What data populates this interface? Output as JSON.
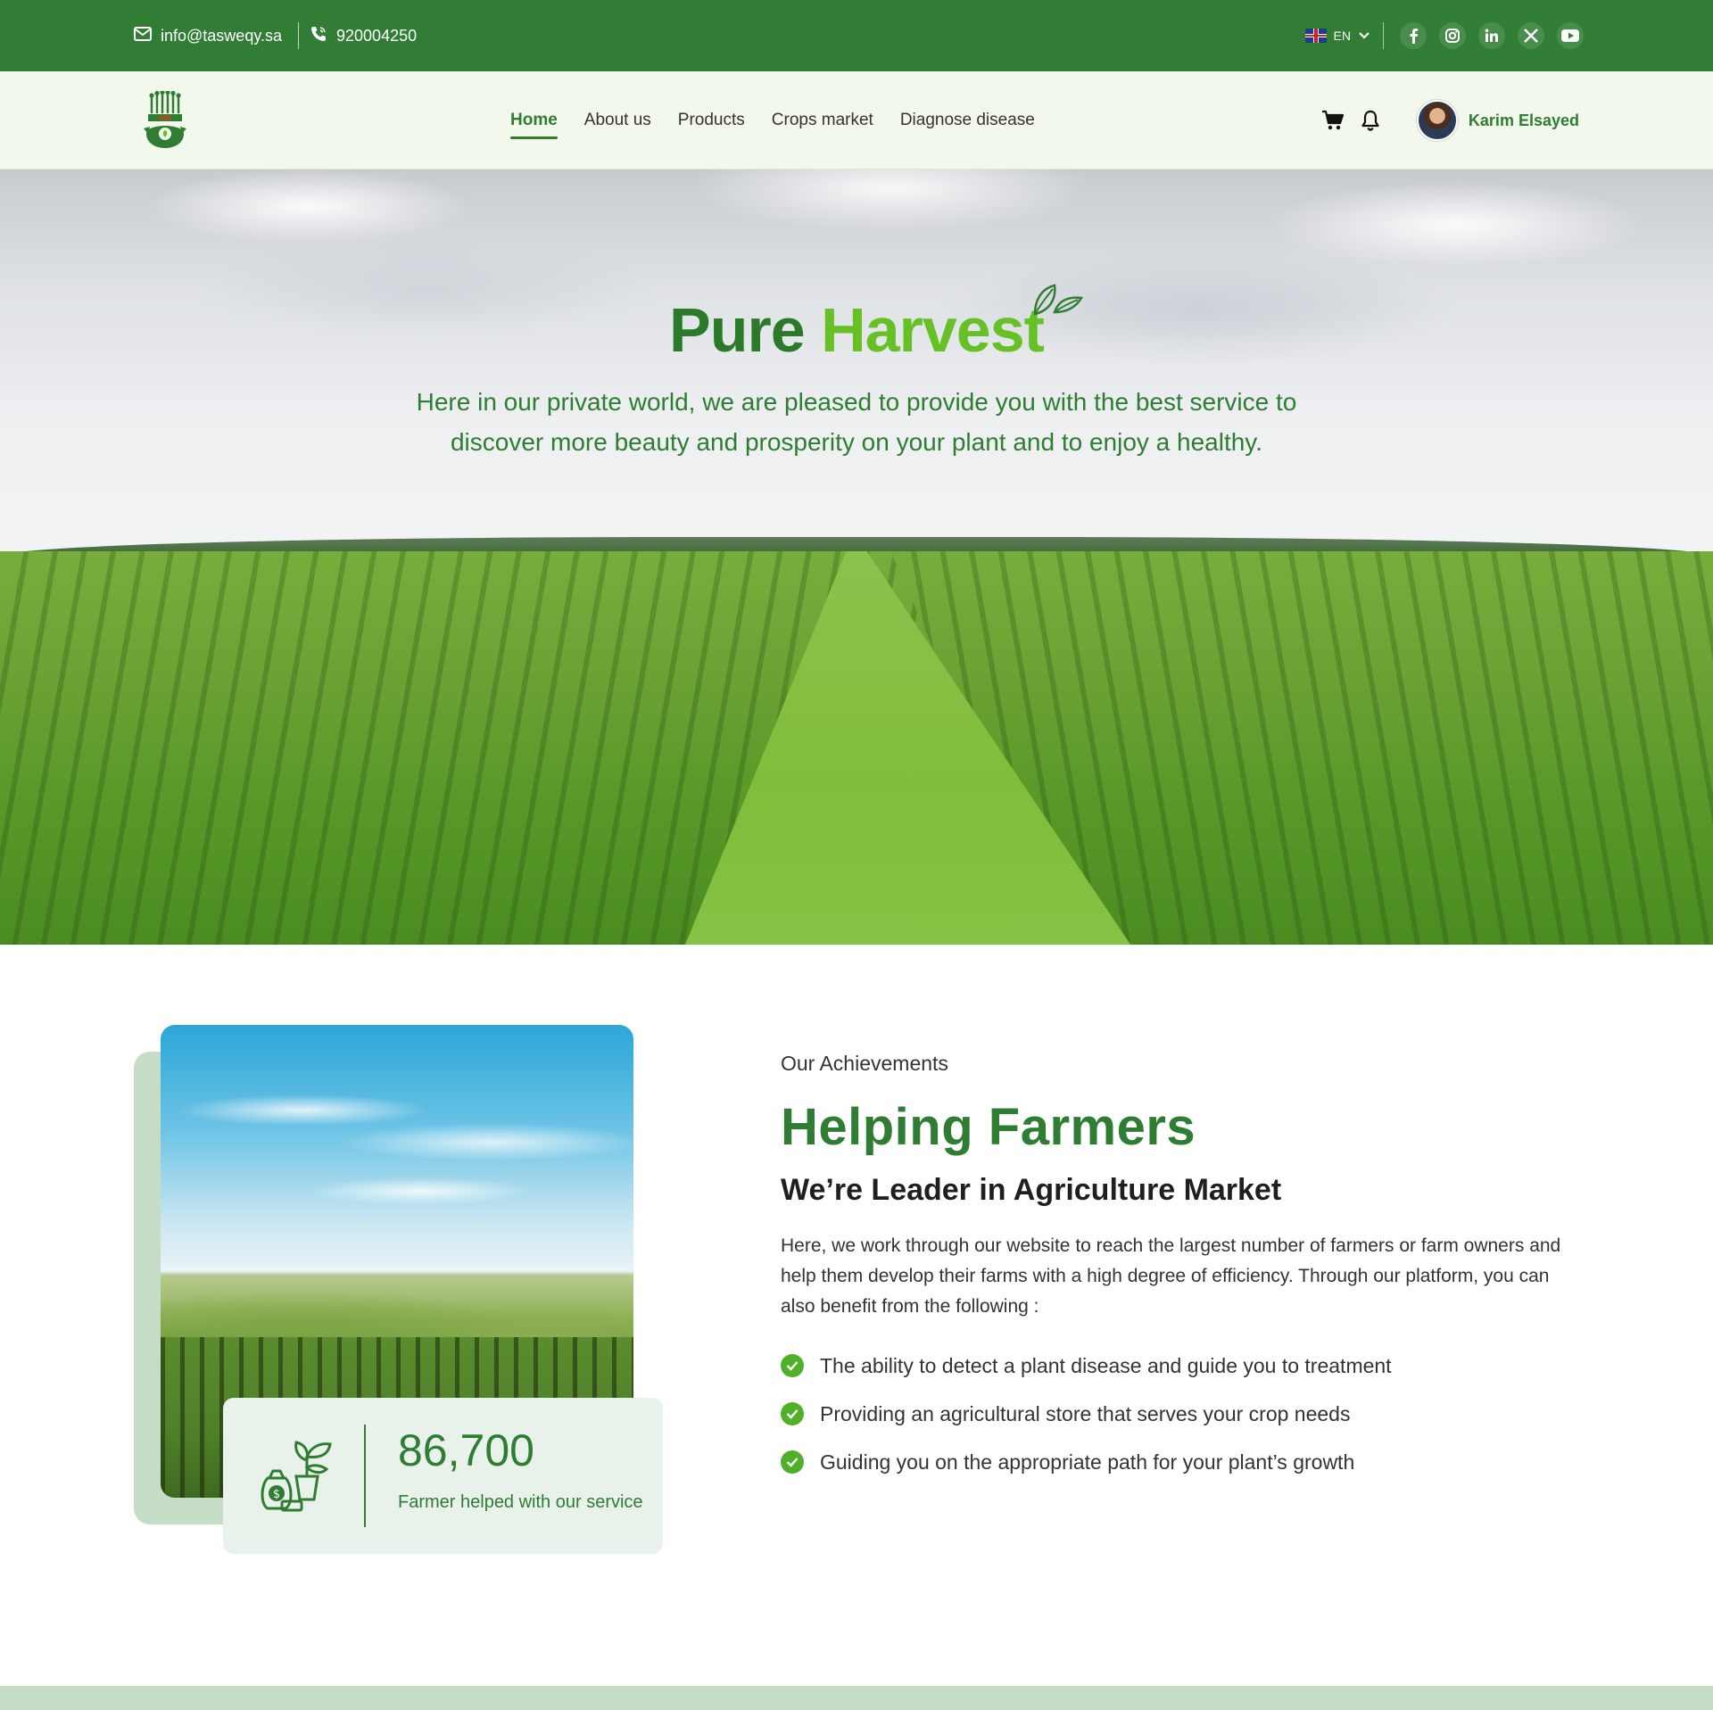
{
  "topbar": {
    "email": "info@tasweqy.sa",
    "phone": "920004250",
    "language": "EN",
    "social": [
      "facebook-icon",
      "instagram-icon",
      "linkedin-icon",
      "x-icon",
      "youtube-icon"
    ]
  },
  "nav": {
    "items": [
      {
        "label": "Home",
        "active": true
      },
      {
        "label": "About us"
      },
      {
        "label": "Products"
      },
      {
        "label": "Crops market"
      },
      {
        "label": "Diagnose disease"
      }
    ],
    "user_name": "Karim Elsayed"
  },
  "hero": {
    "title_part1": "Pure ",
    "title_part2": "Harvest",
    "subtitle": "Here in our private world, we are pleased to provide you with the best service to discover more beauty and prosperity on your plant and to enjoy a healthy."
  },
  "about": {
    "kicker": "Our Achievements",
    "heading": "Helping Farmers",
    "subheading": "We’re Leader in Agriculture Market",
    "paragraph": "Here, we work through our website to reach the largest number of farmers or farm owners and help them develop their farms with a high degree of efficiency. Through our platform, you can also benefit from the following :",
    "bullets": [
      "The ability to detect a plant disease and guide you to treatment",
      "Providing an agricultural store that serves your crop needs",
      "Guiding you on the appropriate path for your plant’s growth"
    ],
    "stat_value": "86,700",
    "stat_label": "Farmer helped with our service"
  },
  "colors": {
    "primary": "#317d35",
    "accent": "#66c026",
    "nav_bg": "#f2f9ec",
    "card_bg": "#e9f2ea"
  }
}
